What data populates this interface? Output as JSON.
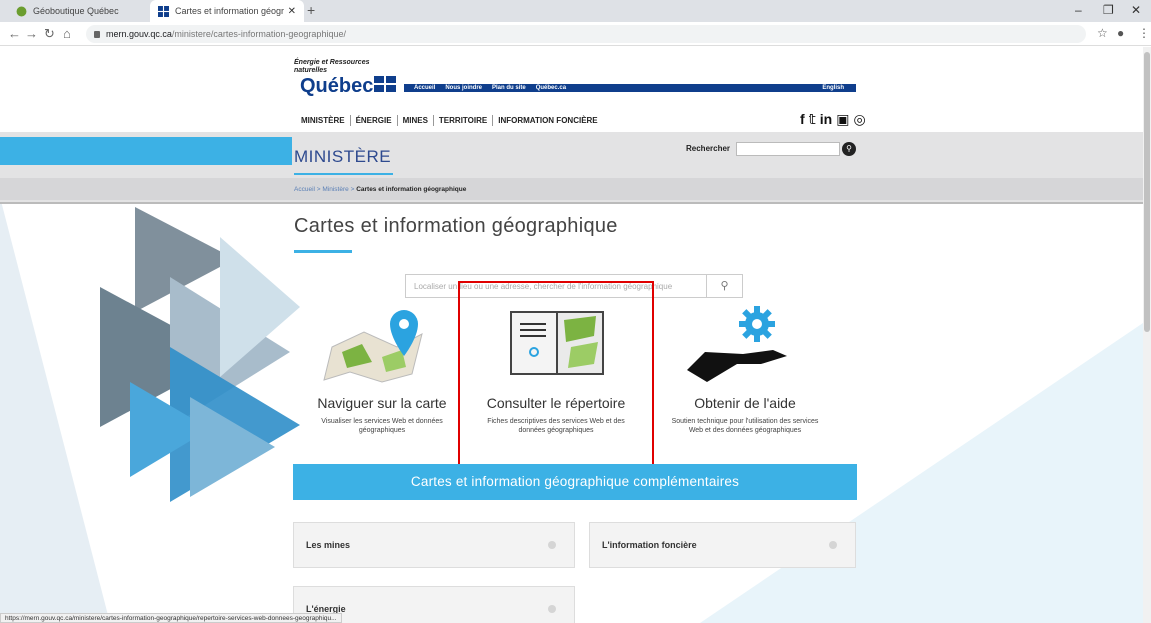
{
  "browser": {
    "tabs": [
      {
        "label": "Géoboutique Québec"
      },
      {
        "label": "Cartes et information géograph..."
      }
    ],
    "url_host": "mern.gouv.qc.ca",
    "url_path": "/ministere/cartes-information-geographique/",
    "status_url": "https://mern.gouv.qc.ca/ministere/cartes-information-geographique/repertoire-services-web-donnees-geographiqu..."
  },
  "header": {
    "ministry": "Énergie et Ressources naturelles",
    "province": "Québec",
    "top_links": [
      "Accueil",
      "Nous joindre",
      "Plan du site",
      "Québec.ca"
    ],
    "english": "English",
    "main_nav": [
      "MINISTÈRE",
      "ÉNERGIE",
      "MINES",
      "TERRITOIRE",
      "INFORMATION FONCIÈRE"
    ],
    "section": "MINISTÈRE",
    "search_label": "Rechercher",
    "breadcrumb": [
      "Accueil",
      "Ministère",
      "Cartes et information géographique"
    ]
  },
  "main": {
    "title": "Cartes et information géographique",
    "search_placeholder": "Localiser un lieu ou une adresse, chercher de l'information géographique",
    "cards": [
      {
        "title": "Naviguer sur la carte",
        "desc": "Visualiser les services Web et données géographiques"
      },
      {
        "title": "Consulter le répertoire",
        "desc": "Fiches descriptives des services Web et des données géographiques"
      },
      {
        "title": "Obtenir de l'aide",
        "desc": "Soutien technique pour l'utilisation des services Web et des données géographiques"
      }
    ],
    "complement": "Cartes et information géographique complémentaires",
    "accordions": [
      "Les mines",
      "L'information foncière",
      "L'énergie"
    ]
  },
  "colors": {
    "accent": "#3cb1e5",
    "brand": "#0f3e8c",
    "highlight": "#e00000"
  }
}
